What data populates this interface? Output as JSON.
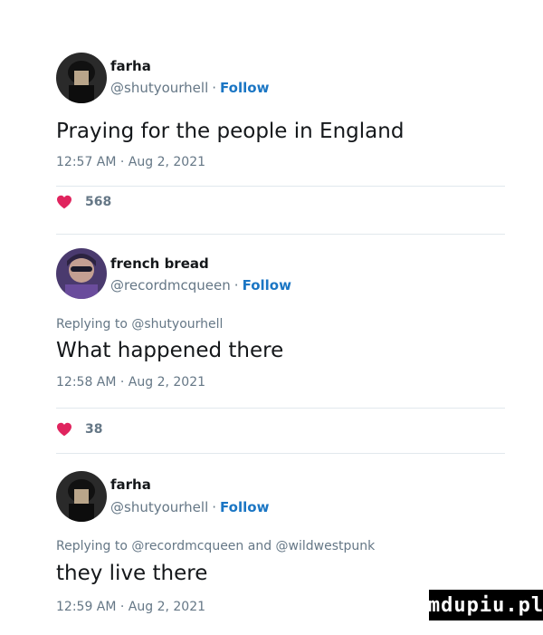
{
  "tweets": [
    {
      "name": "farha",
      "handle": "@shutyourhell",
      "follow": "Follow",
      "replying": "",
      "text": "Praying for the people in England",
      "timestamp": "12:57 AM · Aug 2, 2021",
      "likes": "568"
    },
    {
      "name": "french bread",
      "handle": "@recordmcqueen",
      "follow": "Follow",
      "replying": "Replying to @shutyourhell",
      "text": "What happened there",
      "timestamp": "12:58 AM · Aug 2, 2021",
      "likes": "38"
    },
    {
      "name": "farha",
      "handle": "@shutyourhell",
      "follow": "Follow",
      "replying": "Replying to @recordmcqueen and @wildwestpunk",
      "text": "they live there",
      "timestamp": "12:59 AM · Aug 2, 2021"
    }
  ],
  "separator": "·",
  "watermark": "mdupiu.pl",
  "colors": {
    "follow": "#1b76c4",
    "heart": "#e0245e",
    "muted": "#657786",
    "divider": "#e1e8ed"
  },
  "icons": {
    "like": "heart-icon",
    "avatar": "avatar"
  }
}
